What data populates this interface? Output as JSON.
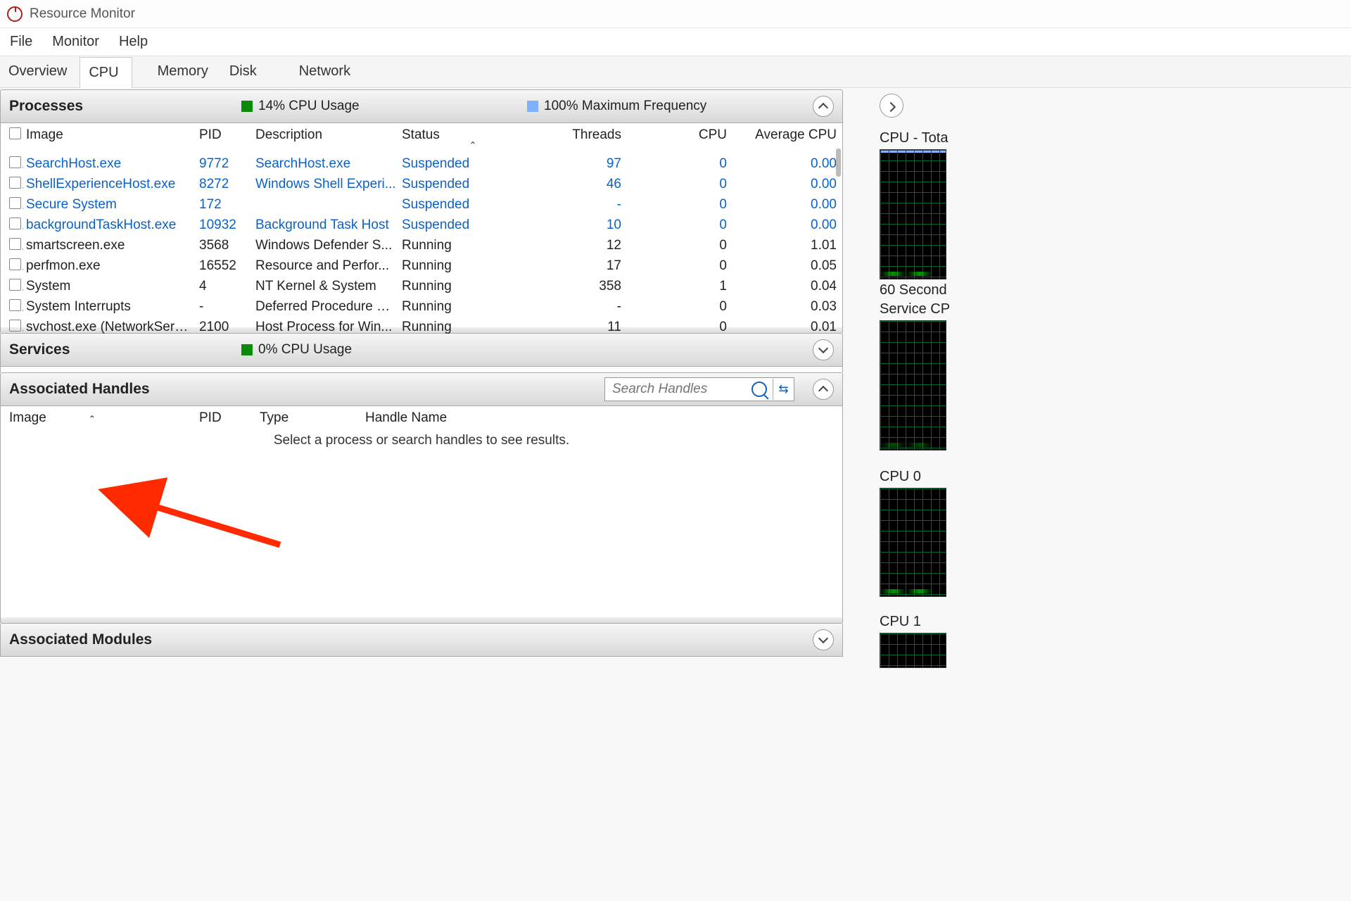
{
  "window": {
    "title": "Resource Monitor"
  },
  "menubar": [
    "File",
    "Monitor",
    "Help"
  ],
  "tabs": [
    "Overview",
    "CPU",
    "Memory",
    "Disk",
    "Network"
  ],
  "active_tab": 1,
  "processes_panel": {
    "title": "Processes",
    "stat1": "14% CPU Usage",
    "stat2": "100% Maximum Frequency",
    "columns": [
      "Image",
      "PID",
      "Description",
      "Status",
      "Threads",
      "CPU",
      "Average CPU"
    ],
    "rows": [
      {
        "sel": true,
        "image": "SearchHost.exe",
        "pid": "9772",
        "desc": "SearchHost.exe",
        "status": "Suspended",
        "threads": "97",
        "cpu": "0",
        "avg": "0.00"
      },
      {
        "sel": true,
        "image": "ShellExperienceHost.exe",
        "pid": "8272",
        "desc": "Windows Shell Experi...",
        "status": "Suspended",
        "threads": "46",
        "cpu": "0",
        "avg": "0.00"
      },
      {
        "sel": true,
        "image": "Secure System",
        "pid": "172",
        "desc": "",
        "status": "Suspended",
        "threads": "-",
        "cpu": "0",
        "avg": "0.00"
      },
      {
        "sel": true,
        "image": "backgroundTaskHost.exe",
        "pid": "10932",
        "desc": "Background Task Host",
        "status": "Suspended",
        "threads": "10",
        "cpu": "0",
        "avg": "0.00"
      },
      {
        "sel": false,
        "image": "smartscreen.exe",
        "pid": "3568",
        "desc": "Windows Defender S...",
        "status": "Running",
        "threads": "12",
        "cpu": "0",
        "avg": "1.01"
      },
      {
        "sel": false,
        "image": "perfmon.exe",
        "pid": "16552",
        "desc": "Resource and Perfor...",
        "status": "Running",
        "threads": "17",
        "cpu": "0",
        "avg": "0.05"
      },
      {
        "sel": false,
        "image": "System",
        "pid": "4",
        "desc": "NT Kernel & System",
        "status": "Running",
        "threads": "358",
        "cpu": "1",
        "avg": "0.04"
      },
      {
        "sel": false,
        "image": "System Interrupts",
        "pid": "-",
        "desc": "Deferred Procedure C...",
        "status": "Running",
        "threads": "-",
        "cpu": "0",
        "avg": "0.03"
      },
      {
        "sel": false,
        "image": "svchost.exe (NetworkService...",
        "pid": "2100",
        "desc": "Host Process for Win...",
        "status": "Running",
        "threads": "11",
        "cpu": "0",
        "avg": "0.01"
      }
    ]
  },
  "services_panel": {
    "title": "Services",
    "stat": "0% CPU Usage"
  },
  "handles_panel": {
    "title": "Associated Handles",
    "search_placeholder": "Search Handles",
    "columns": [
      "Image",
      "PID",
      "Type",
      "Handle Name"
    ],
    "empty": "Select a process or search handles to see results."
  },
  "modules_panel": {
    "title": "Associated Modules"
  },
  "side": {
    "lbl_total": "CPU - Tota",
    "lbl_60": "60 Second",
    "lbl_svc": "Service CP",
    "lbl_cpu0": "CPU 0",
    "lbl_cpu1": "CPU 1"
  },
  "colors": {
    "highlight": "#0a62c9",
    "green": "#0b8a0b",
    "blue": "#7eb2ff"
  }
}
